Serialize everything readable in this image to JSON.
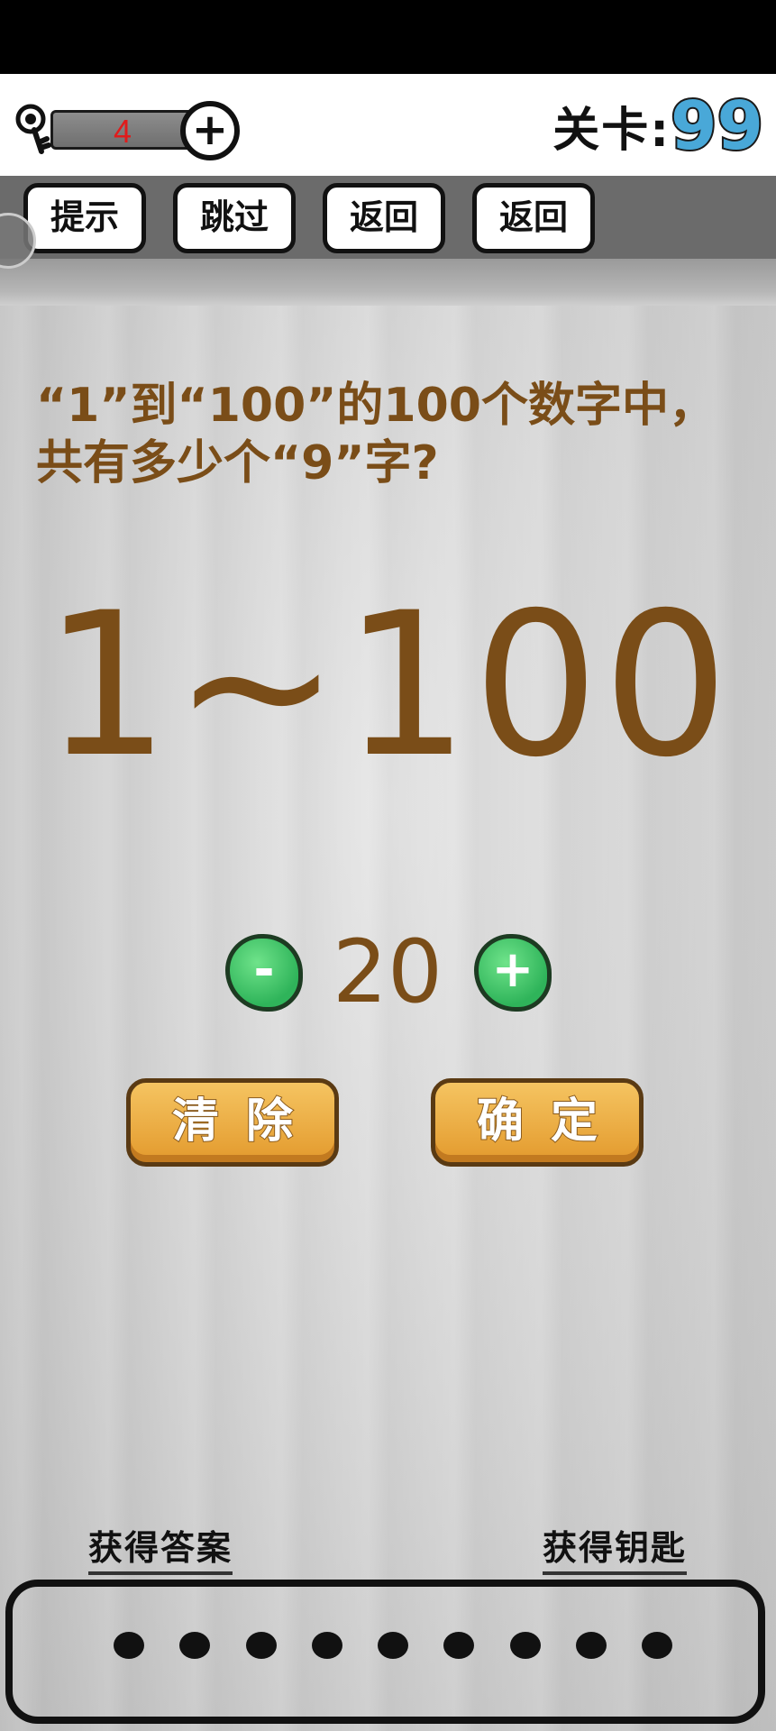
{
  "header": {
    "key_count": "4",
    "level_label": "关卡:",
    "level_number": "99"
  },
  "toolbar": {
    "buttons": [
      "提示",
      "跳过",
      "返回",
      "返回"
    ]
  },
  "question": {
    "text": "“1”到“100”的100个数字中，共有多少个“9”字?",
    "range_display": "1~100"
  },
  "stepper": {
    "minus": "-",
    "value": "20",
    "plus": "+"
  },
  "actions": {
    "clear": "清除",
    "confirm": "确定"
  },
  "footer": {
    "get_answer": "获得答案",
    "get_key": "获得钥匙",
    "dots": 9
  }
}
